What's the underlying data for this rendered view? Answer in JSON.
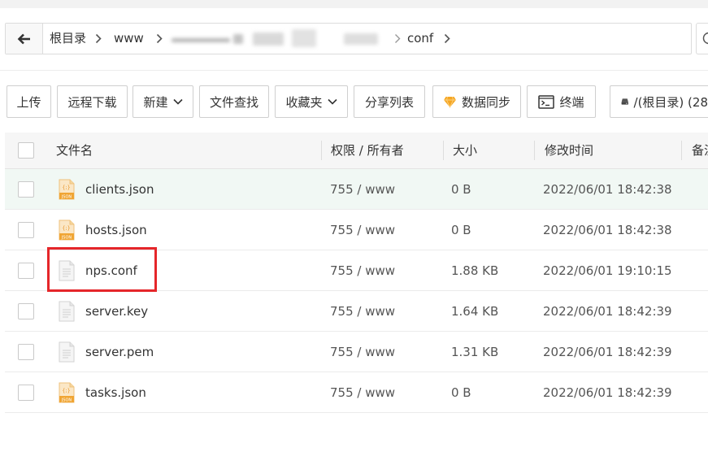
{
  "breadcrumb": {
    "back_icon": "arrow-left-icon",
    "separator_icon": "chevron-right-icon",
    "items": [
      "根目录",
      "www",
      "conf"
    ]
  },
  "search": {
    "icon": "search-icon"
  },
  "toolbar": {
    "upload": "上传",
    "remote_download": "远程下载",
    "new": "新建",
    "find": "文件查找",
    "favorites": "收藏夹",
    "share_list": "分享列表",
    "sync": "数据同步",
    "terminal": "终端",
    "disk": "/(根目录) (28"
  },
  "json_icon": {
    "glyph": "{;}",
    "label": "JSON"
  },
  "table": {
    "columns": {
      "name": "文件名",
      "perm": "权限 / 所有者",
      "size": "大小",
      "mtime": "修改时间",
      "note": "备注"
    },
    "rows": [
      {
        "name": "clients.json",
        "icon": "json-file-icon",
        "perm": "755 / www",
        "size": "0 B",
        "mtime": "2022/06/01 18:42:38",
        "hover": true
      },
      {
        "name": "hosts.json",
        "icon": "json-file-icon",
        "perm": "755 / www",
        "size": "0 B",
        "mtime": "2022/06/01 18:42:38"
      },
      {
        "name": "nps.conf",
        "icon": "text-file-icon",
        "perm": "755 / www",
        "size": "1.88 KB",
        "mtime": "2022/06/01 19:10:15",
        "annotated": true
      },
      {
        "name": "server.key",
        "icon": "text-file-icon",
        "perm": "755 / www",
        "size": "1.64 KB",
        "mtime": "2022/06/01 18:42:39"
      },
      {
        "name": "server.pem",
        "icon": "text-file-icon",
        "perm": "755 / www",
        "size": "1.31 KB",
        "mtime": "2022/06/01 18:42:39"
      },
      {
        "name": "tasks.json",
        "icon": "json-file-icon",
        "perm": "755 / www",
        "size": "0 B",
        "mtime": "2022/06/01 18:42:39"
      }
    ]
  },
  "colors": {
    "annotation": "#e5262a",
    "row_hover": "#f1f8f4",
    "header_bg": "#f6f6f6",
    "sync_diamond": "#f5a623",
    "json_icon": "#f0a533"
  }
}
